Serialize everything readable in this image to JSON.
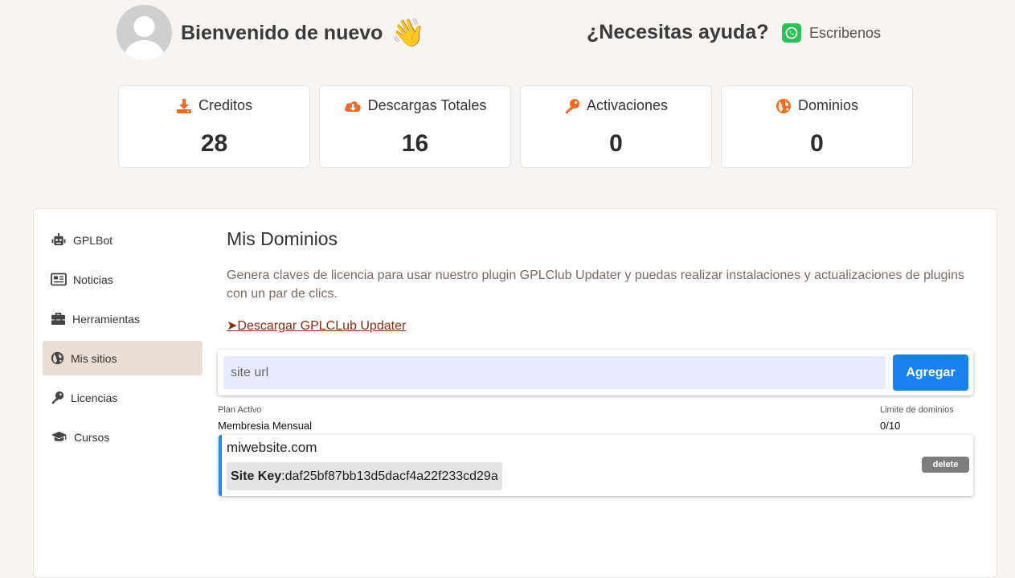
{
  "header": {
    "welcome": "Bienvenido de nuevo",
    "wave_emoji": "👋",
    "help": "¿Necesitas ayuda?",
    "contact_label": "Escribenos"
  },
  "stats": [
    {
      "label": "Creditos",
      "value": "28",
      "icon": "download-icon"
    },
    {
      "label": "Descargas Totales",
      "value": "16",
      "icon": "cloud-download-icon"
    },
    {
      "label": "Activaciones",
      "value": "0",
      "icon": "key-icon"
    },
    {
      "label": "Dominios",
      "value": "0",
      "icon": "globe-icon"
    }
  ],
  "sidebar": {
    "items": [
      {
        "label": "GPLBot",
        "icon": "robot-icon"
      },
      {
        "label": "Noticias",
        "icon": "newspaper-icon"
      },
      {
        "label": "Herramientas",
        "icon": "toolbox-icon"
      },
      {
        "label": "Mis sitios",
        "icon": "globe-icon",
        "active": true
      },
      {
        "label": "Licencias",
        "icon": "key-icon"
      },
      {
        "label": "Cursos",
        "icon": "graduation-cap-icon"
      }
    ]
  },
  "main": {
    "title": "Mis Dominios",
    "description": "Genera claves de licencia para usar nuestro plugin GPLClub Updater y puedas realizar instalaciones y actualizaciones de plugins con un par de clics.",
    "download_link": "➤Descargar GPLCLub Updater",
    "site_input_placeholder": "site url",
    "add_button": "Agregar",
    "plan_label": "Plan Activo",
    "plan_value": "Membresia Mensual",
    "limit_label": "Limite de dominios",
    "limit_value": "0/10",
    "sites": [
      {
        "domain": "miwebsite.com",
        "key_label": "Site Key",
        "key": ":daf25bf87bb13d5dacf4a22f233cd29a",
        "delete_label": "delete"
      }
    ]
  },
  "colors": {
    "accent_orange": "#f26a21",
    "primary_blue": "#1a82f0",
    "active_sidebar": "#eaddd4",
    "whatsapp_green": "#2fbf5a"
  }
}
